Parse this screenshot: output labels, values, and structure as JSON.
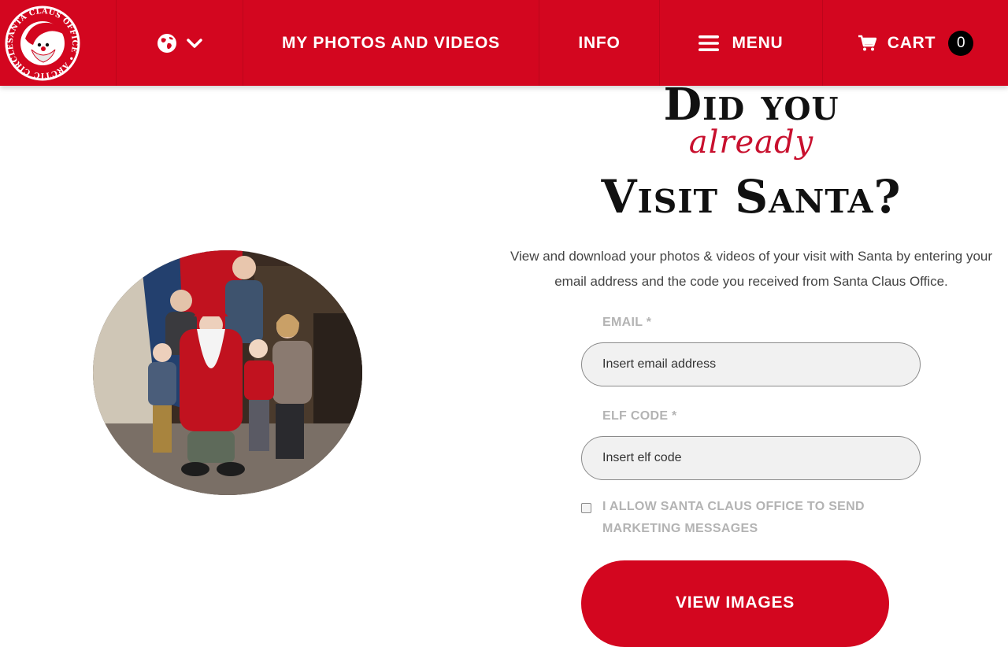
{
  "header": {
    "logo_alt": "Santa Claus Office Arctic Circle Finland",
    "language_icon": "globe-icon",
    "language_caret_icon": "chevron-down-icon",
    "nav": {
      "photos_label": "MY PHOTOS AND VIDEOS",
      "info_label": "INFO",
      "menu_label": "MENU",
      "cart_label": "CART",
      "cart_count": "0"
    }
  },
  "hero": {
    "photo_alt": "Family photo with Santa Claus"
  },
  "headline": {
    "line1": "Did you",
    "line2": "already",
    "line3": "Visit Santa?"
  },
  "intro": {
    "text": "View and download your photos & videos of your visit with Santa by entering your email address and the code you received from Santa Claus Office."
  },
  "form": {
    "email_label": "EMAIL *",
    "email_placeholder": "Insert email address",
    "code_label": "ELF CODE *",
    "code_placeholder": "Insert elf code",
    "consent_label": "I ALLOW SANTA CLAUS OFFICE TO SEND MARKETING MESSAGES",
    "consent_checked": false,
    "submit_label": "VIEW IMAGES"
  },
  "colors": {
    "brand_red": "#d3061f",
    "script_red": "#c8102e",
    "label_grey": "#b3b3b3"
  }
}
